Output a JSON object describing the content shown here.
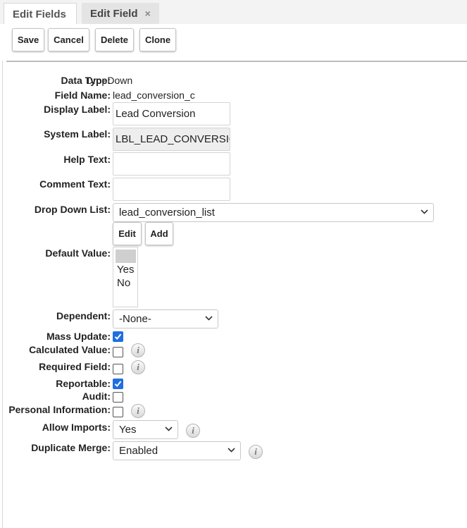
{
  "tabs": [
    {
      "label": "Edit Fields"
    },
    {
      "label": "Edit Field",
      "close_icon": "×"
    }
  ],
  "toolbar": {
    "save_label": "Save",
    "cancel_label": "Cancel",
    "delete_label": "Delete",
    "clone_label": "Clone"
  },
  "fields": {
    "data_type": {
      "label": "Data Type:",
      "value": "DropDown"
    },
    "field_name": {
      "label": "Field Name:",
      "value": "lead_conversion_c"
    },
    "display_label": {
      "label": "Display Label:",
      "value": "Lead Conversion"
    },
    "system_label": {
      "label": "System Label:",
      "value": "LBL_LEAD_CONVERSION"
    },
    "help_text": {
      "label": "Help Text:",
      "value": ""
    },
    "comment_text": {
      "label": "Comment Text:",
      "value": ""
    },
    "drop_down_list": {
      "label": "Drop Down List:",
      "value": "lead_conversion_list",
      "edit_label": "Edit",
      "add_label": "Add"
    },
    "default_value": {
      "label": "Default Value:",
      "options": [
        "",
        "Yes",
        "No"
      ]
    },
    "dependent": {
      "label": "Dependent:",
      "value": "-None-"
    },
    "mass_update": {
      "label": "Mass Update:",
      "checked": true
    },
    "calculated_value": {
      "label": "Calculated Value:",
      "checked": false
    },
    "required_field": {
      "label": "Required Field:",
      "checked": false
    },
    "reportable": {
      "label": "Reportable:",
      "checked": true
    },
    "audit": {
      "label": "Audit:",
      "checked": false
    },
    "personal_information": {
      "label": "Personal Information:",
      "checked": false
    },
    "allow_imports": {
      "label": "Allow Imports:",
      "value": "Yes"
    },
    "duplicate_merge": {
      "label": "Duplicate Merge:",
      "value": "Enabled"
    }
  },
  "info_icon": "i",
  "colors": {
    "checkbox_checked": "#1f6fe0",
    "tab_bar": "#f3f3f3"
  }
}
